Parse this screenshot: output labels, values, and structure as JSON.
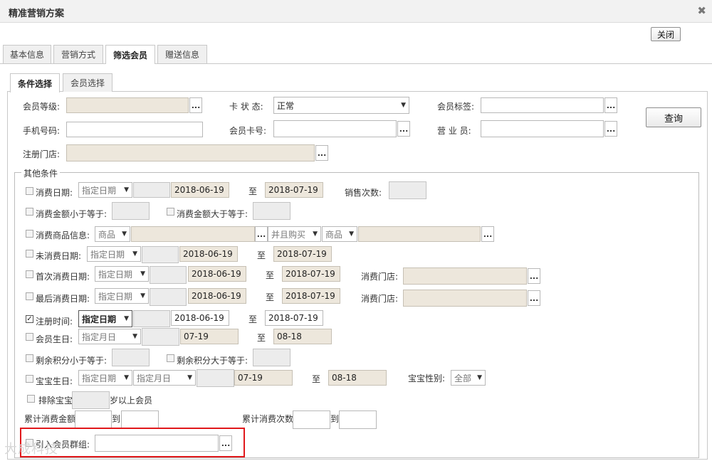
{
  "window": {
    "title": "精准营销方案",
    "close_btn": "关闭"
  },
  "main_tabs": [
    {
      "label": "基本信息"
    },
    {
      "label": "营销方式"
    },
    {
      "label": "筛选会员"
    },
    {
      "label": "赠送信息"
    }
  ],
  "sub_tabs": [
    {
      "label": "条件选择"
    },
    {
      "label": "会员选择"
    }
  ],
  "top": {
    "level_label": "会员等级:",
    "card_state_label": "卡 状 态:",
    "card_state_value": "正常",
    "tag_label": "会员标签:",
    "query_btn": "查询",
    "phone_label": "手机号码:",
    "card_no_label": "会员卡号:",
    "clerk_label": "营 业 员:",
    "store_label": "注册门店:"
  },
  "other": {
    "legend": "其他条件",
    "to": "至",
    "to2": "到",
    "ellipsis": "...",
    "consume_date": {
      "label": "消费日期:",
      "mode": "指定日期",
      "from": "2018-06-19",
      "to": "2018-07-19"
    },
    "sale_times_label": "销售次数:",
    "amount_lte_label": "消费金额小于等于:",
    "amount_gte_label": "消费金额大于等于:",
    "goods": {
      "label": "消费商品信息:",
      "sel1": "商品",
      "sel2": "并且购买",
      "sel3": "商品"
    },
    "no_consume": {
      "label": "未消费日期:",
      "mode": "指定日期",
      "from": "2018-06-19",
      "to": "2018-07-19"
    },
    "first_consume": {
      "label": "首次消费日期:",
      "mode": "指定日期",
      "from": "2018-06-19",
      "to": "2018-07-19",
      "store_label": "消费门店:"
    },
    "last_consume": {
      "label": "最后消费日期:",
      "mode": "指定日期",
      "from": "2018-06-19",
      "to": "2018-07-19",
      "store_label": "消费门店:"
    },
    "reg_time": {
      "label": "注册时间:",
      "mode": "指定日期",
      "from": "2018-06-19",
      "to": "2018-07-19"
    },
    "birthday": {
      "label": "会员生日:",
      "mode": "指定月日",
      "from": "07-19",
      "to": "08-18"
    },
    "points_lte_label": "剩余积分小于等于:",
    "points_gte_label": "剩余积分大于等于:",
    "baby_birthday": {
      "label": "宝宝生日:",
      "mode1": "指定日期",
      "mode2": "指定月日",
      "from": "07-19",
      "to": "08-18",
      "gender_label": "宝宝性别:",
      "gender_value": "全部"
    },
    "exclude_baby_label": "排除宝宝",
    "exclude_baby_suffix": "岁以上会员",
    "total_amount_label": "累计消费金额",
    "total_times_label": "累计消费次数",
    "import_group_label": "引入会员群组:"
  },
  "watermark": "大成科技"
}
